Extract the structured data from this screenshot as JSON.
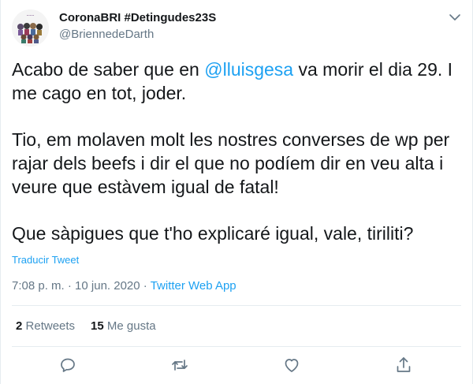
{
  "author": {
    "display_name": "CoronaBRI #Detingudes23S",
    "handle": "@BriennedeDarth"
  },
  "tweet": {
    "p1_before": "Acabo de saber que en ",
    "p1_mention": "@lluisgesa",
    "p1_after": " va morir el dia 29. I me cago en tot, joder.",
    "p2": "Tio, em molaven molt les nostres converses de wp per rajar dels beefs i dir el que no podíem dir en veu alta i veure que estàvem igual de fatal!",
    "p3": "Que sàpigues que t'ho explicaré igual, vale, tiriliti?"
  },
  "translate_label": "Traducir Tweet",
  "meta": {
    "time": "7:08 p. m.",
    "date": "10 jun. 2020",
    "sep": " · ",
    "app": "Twitter Web App"
  },
  "stats": {
    "retweets_count": "2",
    "retweets_label": "Retweets",
    "likes_count": "15",
    "likes_label": "Me gusta"
  },
  "icons": {
    "caret": "chevron-down-icon",
    "reply": "reply-icon",
    "retweet": "retweet-icon",
    "like": "heart-icon",
    "share": "share-icon"
  },
  "colors": {
    "link": "#1da1f2",
    "secondary_text": "#657786",
    "primary_text": "#14171a",
    "border": "#e6ecf0"
  }
}
